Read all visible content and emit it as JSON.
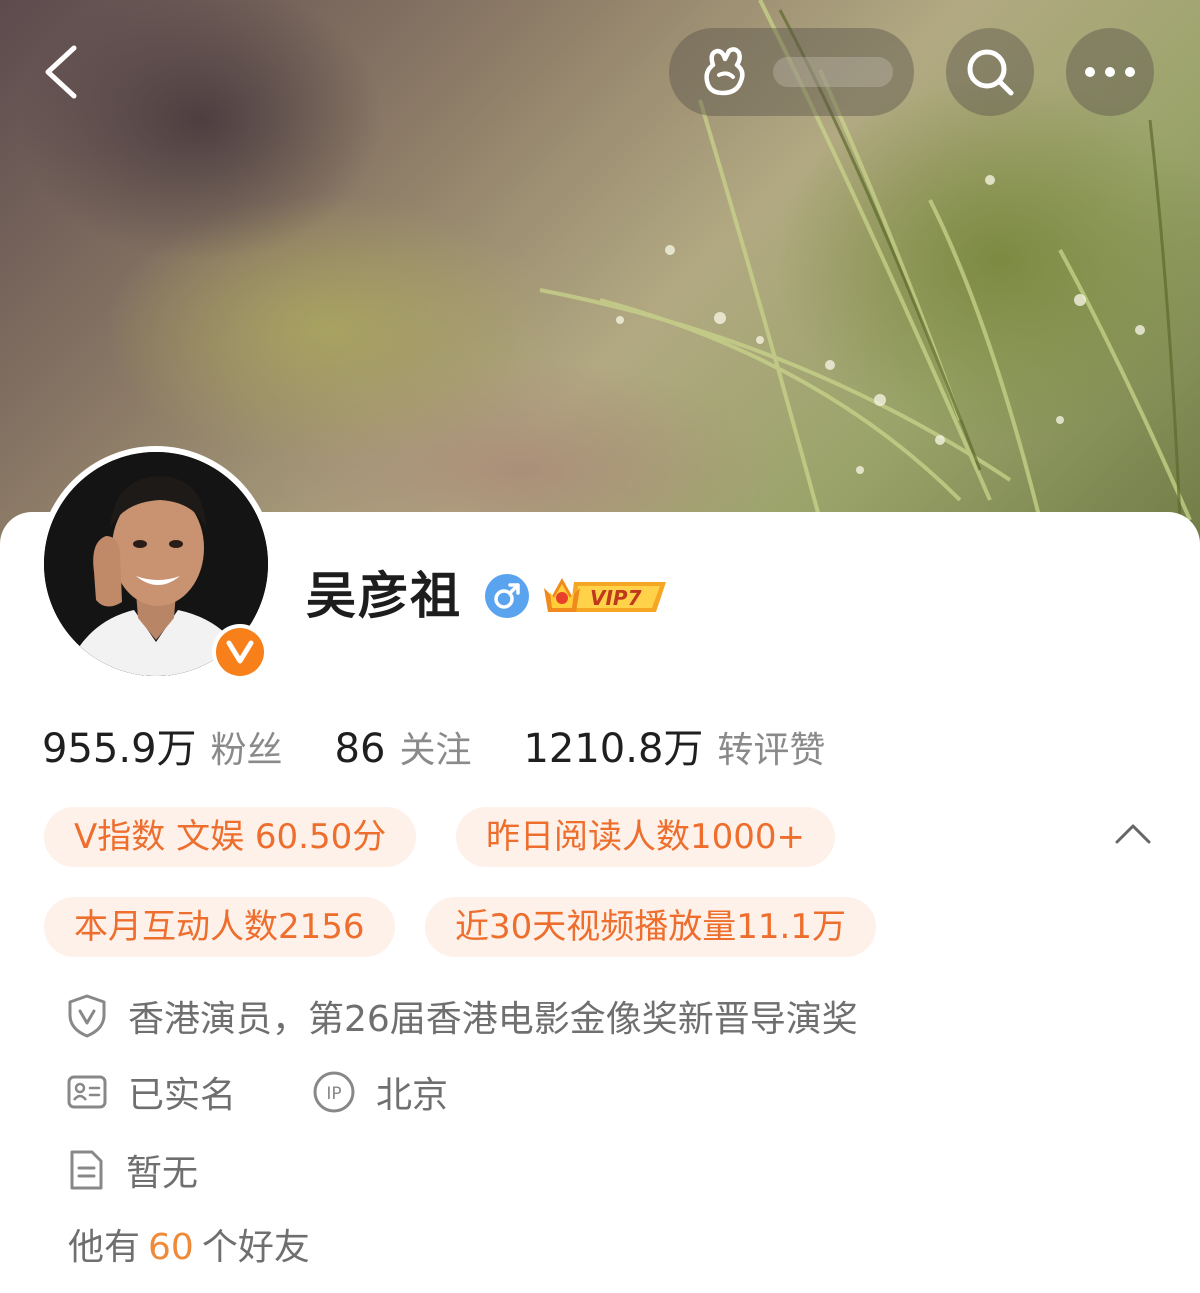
{
  "header": {
    "back_icon": "chevron-left-icon",
    "pill_icon": "hand-wave-icon",
    "search_icon": "search-icon",
    "more_icon": "more-horizontal-icon"
  },
  "profile": {
    "name": "吴彦祖",
    "gender_icon": "male-icon",
    "vip_label": "VIP7",
    "verified_badge": "V"
  },
  "stats": [
    {
      "value": "955.9万",
      "label": "粉丝"
    },
    {
      "value": "86",
      "label": "关注"
    },
    {
      "value": "1210.8万",
      "label": "转评赞"
    }
  ],
  "tags": [
    "V指数 文娱 60.50分",
    "昨日阅读人数1000+",
    "本月互动人数2156",
    "近30天视频播放量11.1万"
  ],
  "info": {
    "verification": "香港演员，第26届香港电影金像奖新晋导演奖",
    "real_name": "已实名",
    "ip_location": "北京",
    "bio": "暂无",
    "ip_badge": "IP"
  },
  "friends": {
    "prefix": "他有",
    "count": "60",
    "suffix": "个好友"
  },
  "colors": {
    "accent": "#ee6e2d",
    "tag_bg": "#fdf1ea",
    "verified": "#f7801a",
    "gender": "#5aa3ef"
  }
}
